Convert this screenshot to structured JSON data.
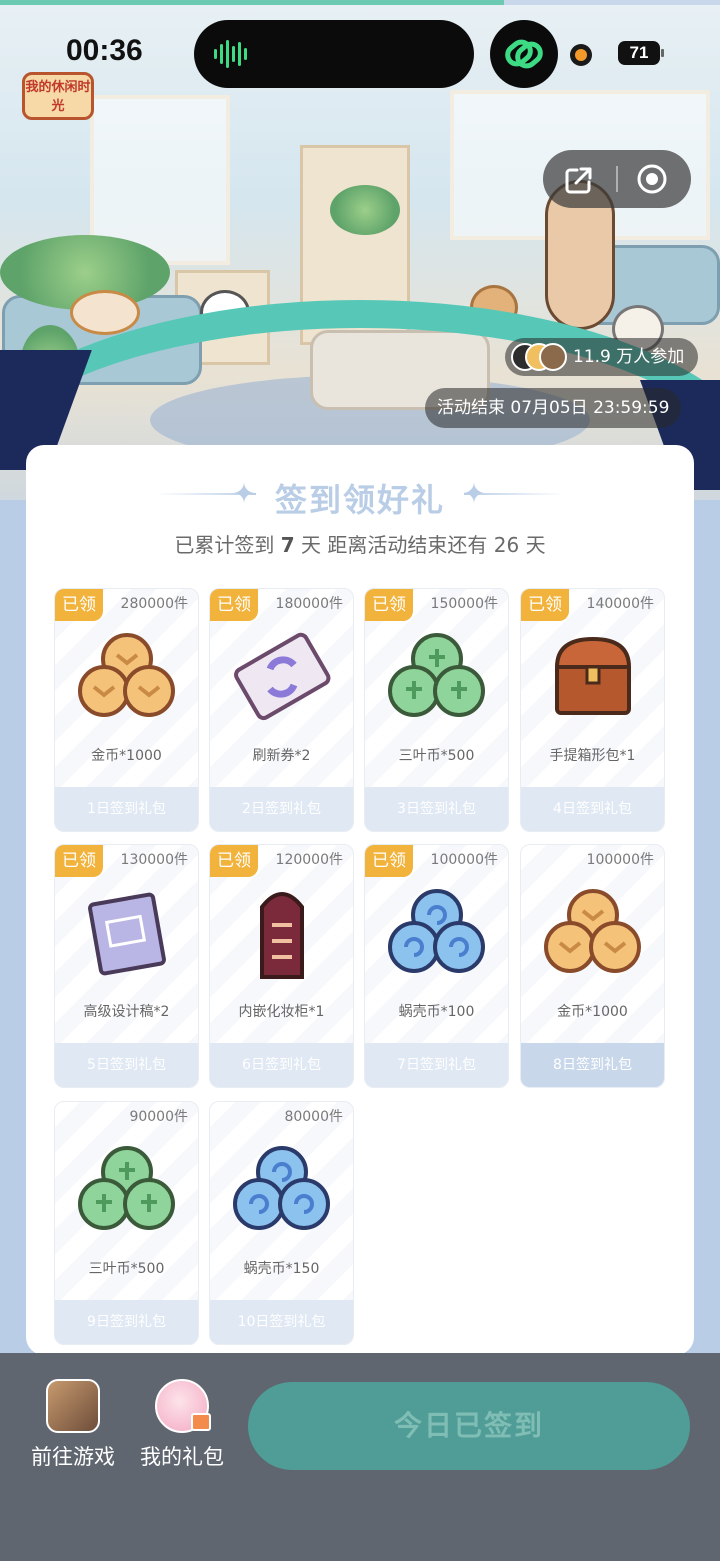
{
  "progress_fraction": 0.7,
  "status_bar": {
    "time": "00:36",
    "battery": "71",
    "icons": [
      "voice-wave-icon",
      "link-rings-icon",
      "record-dot-icon"
    ]
  },
  "hero": {
    "logo_text": "我的休闲时光",
    "participants": "11.9 万人参加",
    "end_time": "活动结束 07月05日 23:59:59",
    "capsule_icons": [
      "share-icon",
      "target-icon"
    ]
  },
  "card": {
    "title": "签到领好礼",
    "subtitle_prefix": "已累计签到",
    "days_signed": "7",
    "subtitle_mid": "天  距离活动结束还有",
    "days_left": "26",
    "subtitle_suffix": "天"
  },
  "rewards": [
    {
      "claimed": "已领",
      "stock": "280000件",
      "name": "金币*1000",
      "day": "1日签到礼包",
      "icon": "gold-coins-icon"
    },
    {
      "claimed": "已领",
      "stock": "180000件",
      "name": "刷新券*2",
      "day": "2日签到礼包",
      "icon": "refresh-ticket-icon"
    },
    {
      "claimed": "已领",
      "stock": "150000件",
      "name": "三叶币*500",
      "day": "3日签到礼包",
      "icon": "clover-coins-icon"
    },
    {
      "claimed": "已领",
      "stock": "140000件",
      "name": "手提箱形包*1",
      "day": "4日签到礼包",
      "icon": "treasure-chest-icon"
    },
    {
      "claimed": "已领",
      "stock": "130000件",
      "name": "高级设计稿*2",
      "day": "5日签到礼包",
      "icon": "blueprint-scroll-icon"
    },
    {
      "claimed": "已领",
      "stock": "120000件",
      "name": "内嵌化妆柜*1",
      "day": "6日签到礼包",
      "icon": "vanity-cabinet-icon"
    },
    {
      "claimed": "已领",
      "stock": "100000件",
      "name": "蜗壳币*100",
      "day": "7日签到礼包",
      "icon": "snail-coins-icon"
    },
    {
      "claimed": "",
      "stock": "100000件",
      "name": "金币*1000",
      "day": "8日签到礼包",
      "icon": "gold-coins-icon"
    },
    {
      "claimed": "",
      "stock": "90000件",
      "name": "三叶币*500",
      "day": "9日签到礼包",
      "icon": "clover-coins-icon"
    },
    {
      "claimed": "",
      "stock": "80000件",
      "name": "蜗壳币*150",
      "day": "10日签到礼包",
      "icon": "snail-coins-icon"
    }
  ],
  "bottom_bar": {
    "go_game": "前往游戏",
    "my_gifts": "我的礼包",
    "signed_button": "今日已签到"
  },
  "colors": {
    "accent_teal": "#4f9d96",
    "claimed_badge": "#f2b33d",
    "page_bg": "#b9cde6",
    "bottom_bar": "#5f6670"
  }
}
